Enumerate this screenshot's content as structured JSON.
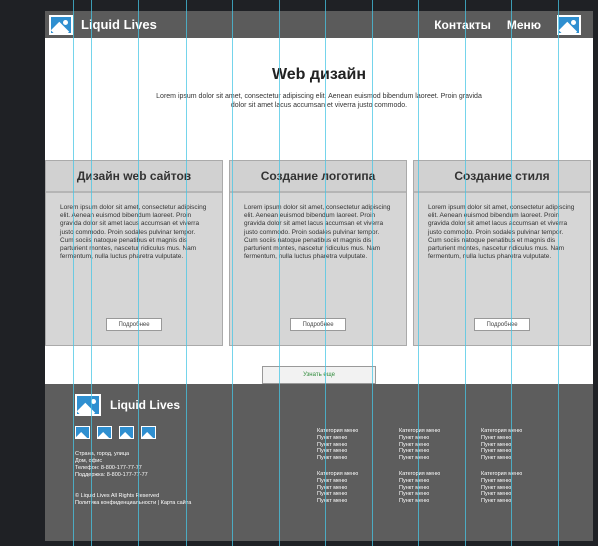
{
  "header": {
    "brand": "Liquid Lives",
    "nav": [
      "Контакты",
      "Меню"
    ]
  },
  "hero": {
    "title": "Web дизайн",
    "text": "Lorem ipsum dolor sit amet, consectetur adipiscing elit. Aenean euismod bibendum laoreet. Proin gravida dolor sit amet lacus accumsan et viverra justo commodo."
  },
  "cards": [
    {
      "title": "Дизайн web сайтов",
      "text": "Lorem ipsum dolor sit amet, consectetur adipiscing elit. Aenean euismod bibendum laoreet. Proin gravida dolor sit amet lacus accumsan et viverra justo commodo. Proin sodales pulvinar tempor. Cum sociis natoque penatibus et magnis dis parturient montes, nascetur ridiculus mus. Nam fermentum, nulla luctus pharetra vulputate.",
      "button": "Подробнее"
    },
    {
      "title": "Создание логотипа",
      "text": "Lorem ipsum dolor sit amet, consectetur adipiscing elit. Aenean euismod bibendum laoreet. Proin gravida dolor sit amet lacus accumsan et viverra justo commodo. Proin sodales pulvinar tempor. Cum sociis natoque penatibus et magnis dis parturient montes, nascetur ridiculus mus. Nam fermentum, nulla luctus pharetra vulputate.",
      "button": "Подробнее"
    },
    {
      "title": "Создание стиля",
      "text": "Lorem ipsum dolor sit amet, consectetur adipiscing elit. Aenean euismod bibendum laoreet. Proin gravida dolor sit amet lacus accumsan et viverra justo commodo. Proin sodales pulvinar tempor. Cum sociis natoque penatibus et magnis dis parturient montes, nascetur ridiculus mus. Nam fermentum, nulla luctus pharetra vulputate.",
      "button": "Подробнее"
    }
  ],
  "more_button": "Узнать еще",
  "footer": {
    "brand": "Liquid Lives",
    "contacts": [
      "Страна, город, улица",
      "Дом, офис",
      "Телефон: 8-800-177-77-77",
      "Поддержка: 8-800-177-77-77"
    ],
    "legal": [
      "© Liquid Lives All Rights Reserved",
      "Политика конфиденциальности | Карта сайта"
    ],
    "menu": {
      "category": "Категория меню",
      "item": "Пункт меню"
    }
  },
  "colors": {
    "header_bg": "#5b5b5b",
    "footer_bg": "#5d5d5d",
    "card_bg": "#d6d6d6",
    "logo_blue": "#2f8fd0",
    "guide_lines": "#47c6e4"
  }
}
